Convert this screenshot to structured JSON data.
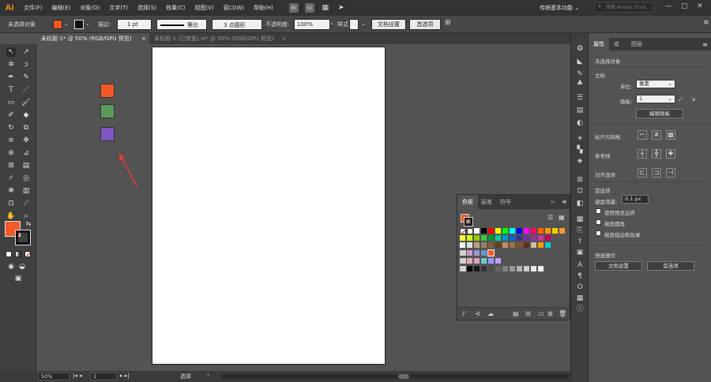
{
  "app": {
    "logo": "Ai",
    "workspace": "传统基本功能",
    "stock_placeholder": "搜索 Adobe Stock",
    "bridge": "Br",
    "stock": "St"
  },
  "menus": [
    "文件(F)",
    "编辑(E)",
    "对象(O)",
    "文字(T)",
    "选择(S)",
    "效果(C)",
    "视图(V)",
    "窗口(W)",
    "帮助(H)"
  ],
  "control": {
    "selection": "未选择对象",
    "fill_color": "#f15a24",
    "stroke_label": "描边:",
    "stroke_value": "1 pt",
    "profile": "等比",
    "brush": "3 点圆形",
    "opacity_label": "不透明度:",
    "opacity_value": "100%",
    "style_label": "样式",
    "doc_settings": "文档设置",
    "preferences": "首选项"
  },
  "tabs": [
    {
      "label": "未标题-1* @ 50% (RGB/GPU 预览)",
      "active": true
    },
    {
      "label": "未标题-1 [已恢复].ai* @ 50% (RGB/GPU 预览)",
      "active": false
    }
  ],
  "canvas": {
    "squares": [
      "#f15a24",
      "#5b9a5b",
      "#7e57c2"
    ],
    "arrow_color": "#e53935"
  },
  "status": {
    "zoom": "50%",
    "artboard": "1",
    "tool": "选择"
  },
  "props": {
    "tabs": [
      "属性",
      "库",
      "图层"
    ],
    "no_selection": "未选择对象",
    "doc_section": "文档",
    "units_label": "单位:",
    "units_value": "像素",
    "artboard_label": "画板:",
    "artboard_value": "1",
    "edit_artboards": "编辑画板",
    "rulers_grids": "标尺与网格",
    "guides": "参考线",
    "align": "对齐选项",
    "prefs_section": "首选项",
    "keyboard_inc_label": "键盘增量:",
    "keyboard_inc_value": "0.1 px",
    "use_preview_bounds": "使用预览边界",
    "scale_corners": "缩放圆角",
    "scale_strokes": "缩放描边和效果",
    "quick_actions": "快速操作",
    "doc_settings": "文档设置",
    "preferences": "首选项"
  },
  "swatches": {
    "tabs": [
      "色板",
      "画笔",
      "符号"
    ],
    "rows": [
      [
        "#ffffff",
        "#000000",
        "#ff0000",
        "#ffff00",
        "#00ff00",
        "#00ffff",
        "#0000ff",
        "#ff00ff",
        "#ff0066",
        "#ff6600",
        "#ff9900",
        "#ffcc00",
        "#ff9933"
      ],
      [
        "#ffff33",
        "#ccff00",
        "#99cc00",
        "#33cc33",
        "#009933",
        "#00cc99",
        "#0099cc",
        "#0066cc",
        "#333399",
        "#663399",
        "#993399",
        "#cc3399",
        "#cc0066"
      ],
      [
        "#f8f8f8",
        "#e0e0e0",
        "#c0a080",
        "#a08060",
        "#806040",
        "#604020",
        "#c09060",
        "#a07040",
        "#805030",
        "#603020",
        "#d0c0a0",
        "#ff9900",
        "#00cccc"
      ],
      [
        "#cc99cc",
        "#9999cc",
        "#6699cc",
        "#f15a24"
      ],
      [
        "#e0b0b0",
        "#e0a0c0",
        "#66cccc",
        "#9999ff",
        "#cc99ff"
      ],
      [
        "#000000",
        "#1a1a1a",
        "#333333",
        "#4d4d4d",
        "#666666",
        "#808080",
        "#999999",
        "#b3b3b3",
        "#cccccc",
        "#e6e6e6",
        "#f2f2f2"
      ]
    ]
  }
}
